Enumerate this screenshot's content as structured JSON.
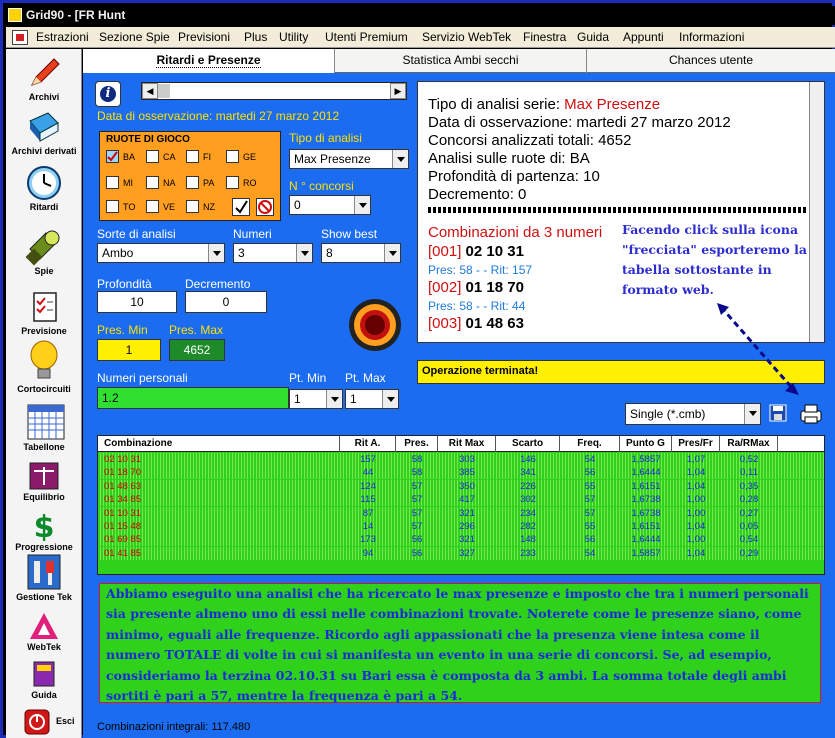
{
  "window": {
    "title": "Grid90 - [FR Hunt"
  },
  "menu": [
    "Estrazioni",
    "Sezione Spie",
    "Previsioni",
    "Plus",
    "Utility",
    "Utenti Premium",
    "Servizio WebTek",
    "Finestra",
    "Guida",
    "Appunti",
    "Informazioni"
  ],
  "sidebar": [
    {
      "label": "Archivi",
      "icon": "pencil-icon"
    },
    {
      "label": "Archivi derivati",
      "icon": "book-icon"
    },
    {
      "label": "Ritardi",
      "icon": "clock-icon"
    },
    {
      "label": "Spie",
      "icon": "flashlight-icon"
    },
    {
      "label": "Previsione",
      "icon": "checklist-icon"
    },
    {
      "label": "Cortocircuiti",
      "icon": "lightbulb-icon"
    },
    {
      "label": "Tabellone",
      "icon": "calendar-grid-icon"
    },
    {
      "label": "Equilibrio",
      "icon": "scale-icon"
    },
    {
      "label": "Progressione",
      "icon": "dollar-icon"
    },
    {
      "label": "Gestione Tek",
      "icon": "tools-icon"
    },
    {
      "label": "WebTek",
      "icon": "webtek-icon"
    },
    {
      "label": "Guida",
      "icon": "help-book-icon"
    },
    {
      "label": "Esci",
      "icon": "exit-icon"
    }
  ],
  "tabs": [
    "Ritardi e Presenze",
    "Statistica Ambi secchi",
    "Chances utente"
  ],
  "form": {
    "data_osservazione": "Data di osservazione:  martedi 27 marzo 2012",
    "ruote_title": "RUOTE DI GIOCO",
    "ruote": [
      {
        "name": "BA",
        "checked": true
      },
      {
        "name": "CA",
        "checked": false
      },
      {
        "name": "FI",
        "checked": false
      },
      {
        "name": "GE",
        "checked": false
      },
      {
        "name": "MI",
        "checked": false
      },
      {
        "name": "NA",
        "checked": false
      },
      {
        "name": "PA",
        "checked": false
      },
      {
        "name": "RO",
        "checked": false
      },
      {
        "name": "TO",
        "checked": false
      },
      {
        "name": "VE",
        "checked": false
      },
      {
        "name": "NZ",
        "checked": false
      }
    ],
    "tipo_label": "Tipo di analisi",
    "tipo_value": "Max Presenze",
    "n_concorsi_label": "N ° concorsi",
    "n_concorsi_value": "0",
    "sorte_label": "Sorte di analisi",
    "sorte_value": "Ambo",
    "numeri_label": "Numeri",
    "numeri_value": "3",
    "showbest_label": "Show best",
    "showbest_value": "8",
    "profondita_label": "Profondità",
    "profondita_value": "10",
    "decremento_label": "Decremento",
    "decremento_value": "0",
    "presmin_label": "Pres. Min",
    "presmin_value": "1",
    "presmax_label": "Pres. Max",
    "presmax_value": "4652",
    "numeri_pers_label": "Numeri personali",
    "numeri_pers_value": "1.2",
    "ptmin_label": "Pt. Min",
    "ptmin_value": "1",
    "ptmax_label": "Pt. Max",
    "ptmax_value": "1"
  },
  "report": {
    "lines": [
      {
        "prefix": "Tipo di analisi serie: ",
        "value": "Max Presenze"
      },
      {
        "text": "Data di osservazione: martedi 27 marzo 2012"
      },
      {
        "text": "Concorsi analizzati totali: 4652"
      },
      {
        "text": "Analisi sulle ruote di: BA"
      },
      {
        "text": "Profondità di partenza: 10"
      },
      {
        "text": "Decremento: 0"
      }
    ],
    "comb_title": "Combinazioni da 3 numeri",
    "items": [
      {
        "idx": "[001]",
        "nums": "02 10 31",
        "stats": "Pres: 58 - - Rit: 157"
      },
      {
        "idx": "[002]",
        "nums": "01 18 70",
        "stats": "Pres: 58 - - Rit: 44"
      },
      {
        "idx": "[003]",
        "nums": "01 48 63"
      }
    ]
  },
  "annotation": "Facendo click sulla icona \"frecciata\" esporteremo la tabella sottostante in formato web.",
  "status": "Operazione terminata!",
  "export_format": "Single (*.cmb)",
  "table": {
    "headers": [
      "Combinazione",
      "Rit A.",
      "Pres.",
      "Rit Max",
      "Scarto",
      "Freq.",
      "Punto G",
      "Pres/Fr",
      "Ra/RMax"
    ],
    "rows": [
      [
        "02 10 31",
        "157",
        "58",
        "303",
        "146",
        "54",
        "1,5857",
        "1,07",
        "0,52"
      ],
      [
        "01 18 70",
        "44",
        "58",
        "385",
        "341",
        "56",
        "1,6444",
        "1,04",
        "0,11"
      ],
      [
        "01 48 63",
        "124",
        "57",
        "350",
        "226",
        "55",
        "1,6151",
        "1,04",
        "0,35"
      ],
      [
        "01 34 85",
        "115",
        "57",
        "417",
        "302",
        "57",
        "1,6738",
        "1,00",
        "0,28"
      ],
      [
        "01 10 31",
        "87",
        "57",
        "321",
        "234",
        "57",
        "1,6738",
        "1,00",
        "0,27"
      ],
      [
        "01 15 48",
        "14",
        "57",
        "296",
        "282",
        "55",
        "1,6151",
        "1,04",
        "0,05"
      ],
      [
        "01 69 85",
        "173",
        "56",
        "321",
        "148",
        "56",
        "1,6444",
        "1,00",
        "0,54"
      ],
      [
        "01 41 85",
        "94",
        "56",
        "327",
        "233",
        "54",
        "1,5857",
        "1,04",
        "0,29"
      ]
    ]
  },
  "note": "Abbiamo eseguito una analisi che ha ricercato le max presenze e imposto che tra i numeri personali sia presente almeno uno di essi nelle combinazioni trovate. Noterete come le presenze siano, come minimo, eguali alle frequenze. Ricordo agli appassionati che la presenza viene intesa come il numero TOTALE di volte in cui si manifesta un evento in una serie di concorsi. Se, ad esempio, consideriamo la terzina 02.10.31 su Bari essa è composta da 3 ambi. La somma totale degli ambi sortiti è pari a 57, mentre la frequenza è pari a 54.",
  "footer": "Combinazioni integrali: 117.480",
  "colors": {
    "main_bg": "#1b6cf0",
    "grid_green": "#2fd11a",
    "orange": "#ff9e1f",
    "yellow": "#ffef00"
  }
}
